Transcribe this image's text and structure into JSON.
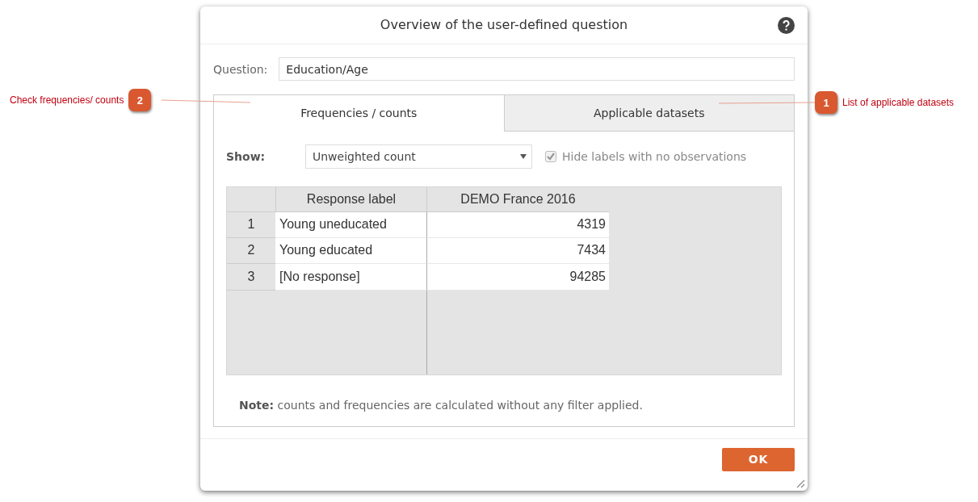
{
  "dialog": {
    "title": "Overview of the user-defined question",
    "question": {
      "label": "Question:",
      "value": "Education/Age"
    },
    "tabs": [
      {
        "label": "Frequencies / counts",
        "selected": true
      },
      {
        "label": "Applicable datasets",
        "selected": false
      }
    ],
    "show": {
      "label": "Show:",
      "value": "Unweighted count"
    },
    "hide_empty": {
      "label": "Hide labels with no observations",
      "checked": true
    },
    "table": {
      "columns": [
        "Response label",
        "DEMO France 2016"
      ],
      "rows": [
        {
          "index": "1",
          "label": "Young uneducated",
          "count": "4319"
        },
        {
          "index": "2",
          "label": "Young educated",
          "count": "7434"
        },
        {
          "index": "3",
          "label": "[No response]",
          "count": "94285"
        }
      ]
    },
    "note": "**Note:** counts and frequencies are calculated without any filter applied.",
    "ok": "OK"
  },
  "callouts": [
    {
      "number": "2",
      "text": "Check frequencies/ counts"
    },
    {
      "number": "1",
      "text": "List of applicable datasets"
    }
  ]
}
